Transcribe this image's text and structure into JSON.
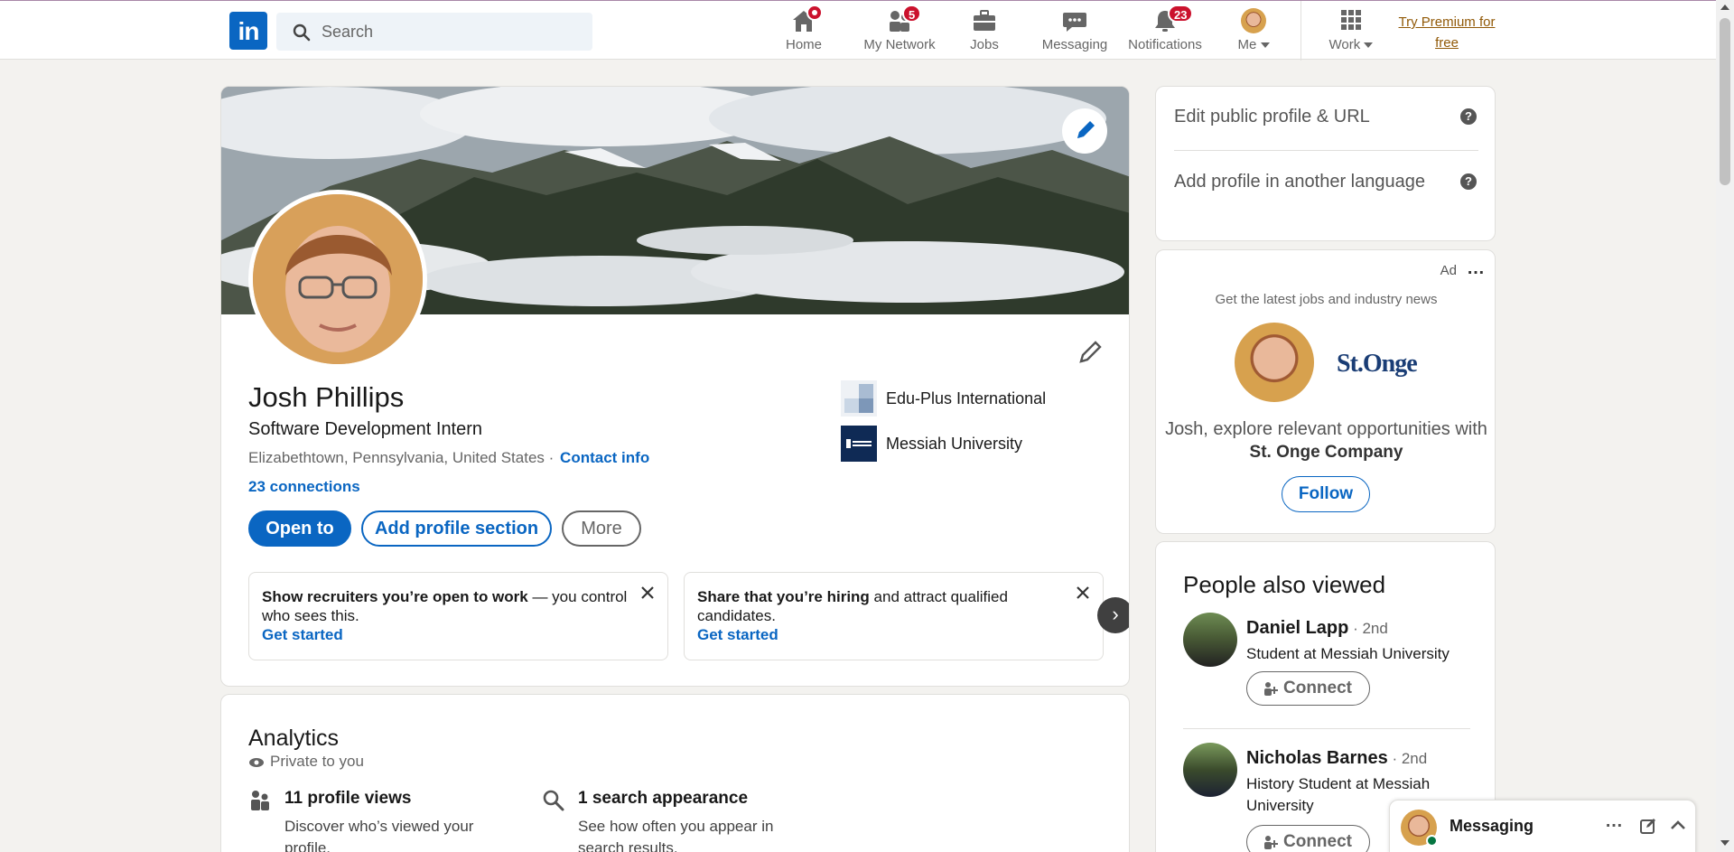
{
  "nav": {
    "logo_text": "in",
    "search_placeholder": "Search",
    "items": [
      {
        "label": "Home",
        "icon": "home-icon",
        "badge": ""
      },
      {
        "label": "My Network",
        "icon": "network-icon",
        "badge": "5"
      },
      {
        "label": "Jobs",
        "icon": "briefcase-icon",
        "badge": ""
      },
      {
        "label": "Messaging",
        "icon": "messaging-icon",
        "badge": ""
      },
      {
        "label": "Notifications",
        "icon": "bell-icon",
        "badge": "23"
      },
      {
        "label": "Me",
        "icon": "avatar",
        "badge": ""
      },
      {
        "label": "Work",
        "icon": "grid-icon",
        "badge": ""
      }
    ],
    "premium_line1": "Try Premium for",
    "premium_line2": "free"
  },
  "profile": {
    "name": "Josh Phillips",
    "headline": "Software Development Intern",
    "location": "Elizabethtown, Pennsylvania, United States ·",
    "contact_info": "Contact info",
    "connections": "23 connections",
    "buttons": {
      "open_to": "Open to",
      "add_section": "Add profile section",
      "more": "More"
    },
    "orgs": [
      {
        "name": "Edu-Plus International"
      },
      {
        "name": "Messiah University"
      }
    ],
    "tips": [
      {
        "bold": "Show recruiters you’re open to work",
        "rest": " — you control who sees this.",
        "cta": "Get started"
      },
      {
        "bold": "Share that you’re hiring",
        "rest": " and attract qualified candidates.",
        "cta": "Get started"
      }
    ],
    "carousel_next": "›"
  },
  "analytics": {
    "title": "Analytics",
    "private": "Private to you",
    "items": [
      {
        "title": "11 profile views",
        "desc": "Discover who’s viewed your profile."
      },
      {
        "title": "1 search appearance",
        "desc": "See how often you appear in search results."
      }
    ]
  },
  "right": {
    "edit_public": "Edit public profile & URL",
    "add_language": "Add profile in another language",
    "help": "?"
  },
  "ad": {
    "label": "Ad",
    "more": "…",
    "sub": "Get the latest jobs and industry news",
    "logo_text": "St.Onge",
    "text": "Josh, explore relevant opportunities with",
    "company": "St. Onge Company",
    "follow": "Follow"
  },
  "people_also_viewed": {
    "title": "People also viewed",
    "people": [
      {
        "name": "Daniel Lapp",
        "degree": " · 2nd",
        "role": "Student at Messiah University",
        "action": "Connect"
      },
      {
        "name": "Nicholas Barnes",
        "degree": " · 2nd",
        "role": "History Student at Messiah University",
        "action": "Connect"
      }
    ]
  },
  "messaging": {
    "title": "Messaging",
    "more": "…"
  },
  "colors": {
    "brand": "#0a66c2",
    "badge": "#cb112d",
    "premium": "#915907",
    "online": "#057642"
  }
}
